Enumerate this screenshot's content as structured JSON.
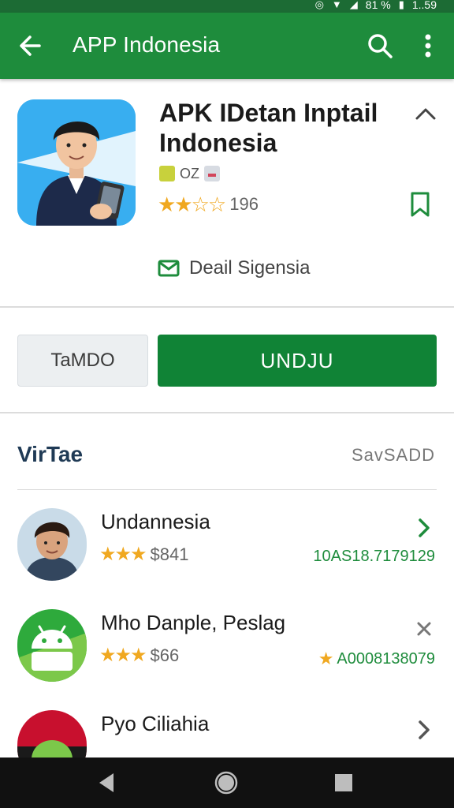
{
  "status_bar": {
    "clock": "1..59",
    "signal_text": "81 %"
  },
  "app_bar": {
    "title": "APP Indonesia",
    "icons": [
      "back-arrow-icon",
      "search-icon",
      "more-vert-icon"
    ]
  },
  "app": {
    "name": "APK IDetan Inptail Indonesia",
    "meta_text": "OZ",
    "rating_stars": 2.5,
    "rating_count": "196",
    "developer": "Deail Sigensia"
  },
  "buttons": {
    "secondary_label": "TaMDO",
    "primary_label": "UNDJU"
  },
  "section": {
    "title": "VirTae",
    "more_label": "SavSADD"
  },
  "list": [
    {
      "name": "Undannesia",
      "stars": "★★★",
      "price": "$841",
      "meta": "10AS18.7179129",
      "meta_star": "",
      "action": "chevron-right-icon"
    },
    {
      "name": "Mho Danple, Peslag",
      "stars": "★★★",
      "price": "$66",
      "meta": "A0008138079",
      "meta_star": "★",
      "action": "close-icon"
    },
    {
      "name": "Pyo Ciliahia",
      "stars": "",
      "price": "",
      "meta": "",
      "meta_star": "",
      "action": "chevron-right-icon"
    }
  ],
  "colors": {
    "primary": "#1e8c3c",
    "primary_dark": "#1c6b34",
    "button_primary": "#108336",
    "star": "#f0a820"
  }
}
